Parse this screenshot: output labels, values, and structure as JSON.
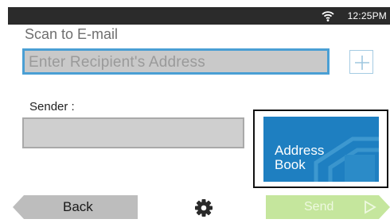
{
  "status_bar": {
    "time": "12:25PM",
    "wifi_icon": "wifi-icon"
  },
  "title": "Scan to E-mail",
  "recipient": {
    "placeholder": "Enter Recipient's Address",
    "add_icon": "plus-icon"
  },
  "sender": {
    "label": "Sender :",
    "value": ""
  },
  "address_book": {
    "line1": "Address",
    "line2": "Book"
  },
  "bottom_bar": {
    "back_label": "Back",
    "settings_icon": "gear-icon",
    "send_label": "Send",
    "send_icon": "play-arrow-icon"
  },
  "colors": {
    "status_bar": "#2b2b2b",
    "accent_blue": "#1e7fc1",
    "field_border": "#4a9fd4",
    "send_green": "#c5e69d",
    "back_gray": "#bdbdbd"
  }
}
